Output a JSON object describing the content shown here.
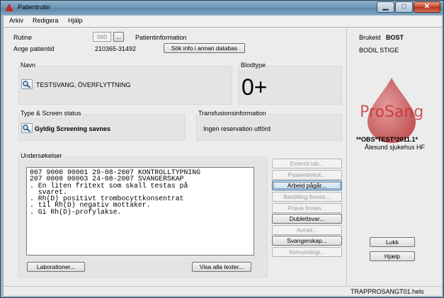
{
  "window": {
    "title": "Patientrutin",
    "controls": {
      "minimize": "▁",
      "maximize": "□",
      "close": "✕"
    }
  },
  "menu": [
    "Arkiv",
    "Redigera",
    "Hjälp"
  ],
  "top": {
    "rutine_label": "Rutine",
    "rutine_value": "000",
    "rutine_btn": "...",
    "patientinfo_label": "Patientinformation",
    "patientid_label": "Ange patientid",
    "patientid_value": "210365-31492",
    "search_other_db": "Sök info i annan databas"
  },
  "navn": {
    "title": "Navn",
    "value": "TESTSVANG, ÖVERFLYTTNING"
  },
  "blodtype": {
    "title": "Blodtype",
    "value": "0+"
  },
  "screen": {
    "title": "Type & Screen status",
    "value": "Gyldig Screening savnes"
  },
  "transfusion": {
    "title": "Transfusionsinformation",
    "value": "Ingen reservation utförd"
  },
  "undersokelser": {
    "title": "Undersøkelser",
    "lines": [
      "007 9000 90001 29-08-2007 KONTROLLTYPNING",
      "207 0000 00003 24-08-2007 SVANGERSKAP",
      ". En liten fritext som skall testas på",
      "  svaret.",
      ". Rh(D) positivt trombocyttkonsentrat",
      ". til Rh(D) negativ mottaker.",
      ". Gi Rh(D)-profylakse."
    ],
    "laboratorier_btn": "Laborationer...",
    "visa_texter_btn": "Visa alla texter..."
  },
  "side_buttons": [
    {
      "label": "Externt lab...",
      "enabled": false
    },
    {
      "label": "Pasienttekst...",
      "enabled": false
    },
    {
      "label": "Arbeid pågår...",
      "enabled": true,
      "focused": true
    },
    {
      "label": "Bestilling finnes...",
      "enabled": false
    },
    {
      "label": "Prøve finnes...",
      "enabled": false
    },
    {
      "label": "Dublettsvar...",
      "enabled": true
    },
    {
      "label": "Annet...",
      "enabled": false
    },
    {
      "label": "Svangerskap...",
      "enabled": true
    },
    {
      "label": "Immunologi...",
      "enabled": false
    }
  ],
  "right": {
    "brukerid_label": "Brukeid",
    "brukerid_value": "BOST",
    "user_name": "BODIL STIGE",
    "logo_text": "ProSang",
    "logo_color": "#c0282a",
    "version": "**OBS*TEST*2011.1*",
    "hospital": "Ålesund sjukehus HF",
    "lukk_btn": "Lukk",
    "hjelp_btn": "Hjælp"
  },
  "status": {
    "text": "TRAPPROSANGT01.hels"
  }
}
